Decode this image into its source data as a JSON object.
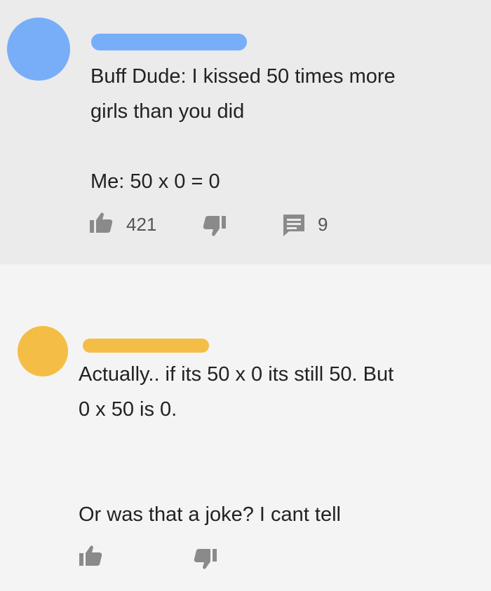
{
  "colors": {
    "avatar_1": "#78aef8",
    "avatar_2": "#f4bd45",
    "icon_gray": "#8a8a8a"
  },
  "comments": [
    {
      "text": "Buff Dude: I kissed 50 times more\ngirls than you did\n\nMe: 50 x 0 = 0",
      "likes": "421",
      "replies": "9",
      "icons": [
        "thumbs-up-icon",
        "thumbs-down-icon",
        "reply-comment-icon"
      ]
    },
    {
      "text": "Actually.. if its 50 x 0 its still 50. But\n0 x 50 is 0.\n\n\nOr was that a joke? I cant tell",
      "icons": [
        "thumbs-up-icon",
        "thumbs-down-icon"
      ]
    }
  ]
}
